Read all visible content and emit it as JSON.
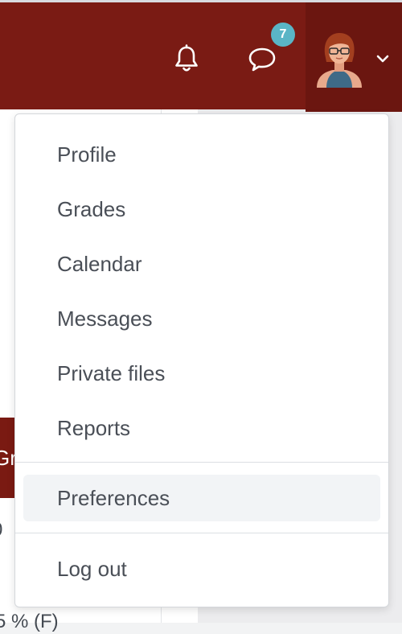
{
  "background": {
    "table_header_fragment": "Gr",
    "cell_fragment": "0",
    "bottom_fragment": "5 % (F)"
  },
  "navbar": {
    "background_color": "#7a1b14",
    "notifications_icon": "bell-icon",
    "messages_icon": "speech-bubble-icon",
    "messages_badge": "7",
    "badge_color": "#5ab5c6",
    "user_avatar": "avatar",
    "user_menu_toggle_icon": "chevron-down-icon"
  },
  "user_menu": {
    "items": [
      {
        "label": "Profile"
      },
      {
        "label": "Grades"
      },
      {
        "label": "Calendar"
      },
      {
        "label": "Messages"
      },
      {
        "label": "Private files"
      },
      {
        "label": "Reports"
      },
      {
        "label": "Preferences",
        "active": true
      },
      {
        "label": "Log out"
      }
    ]
  }
}
